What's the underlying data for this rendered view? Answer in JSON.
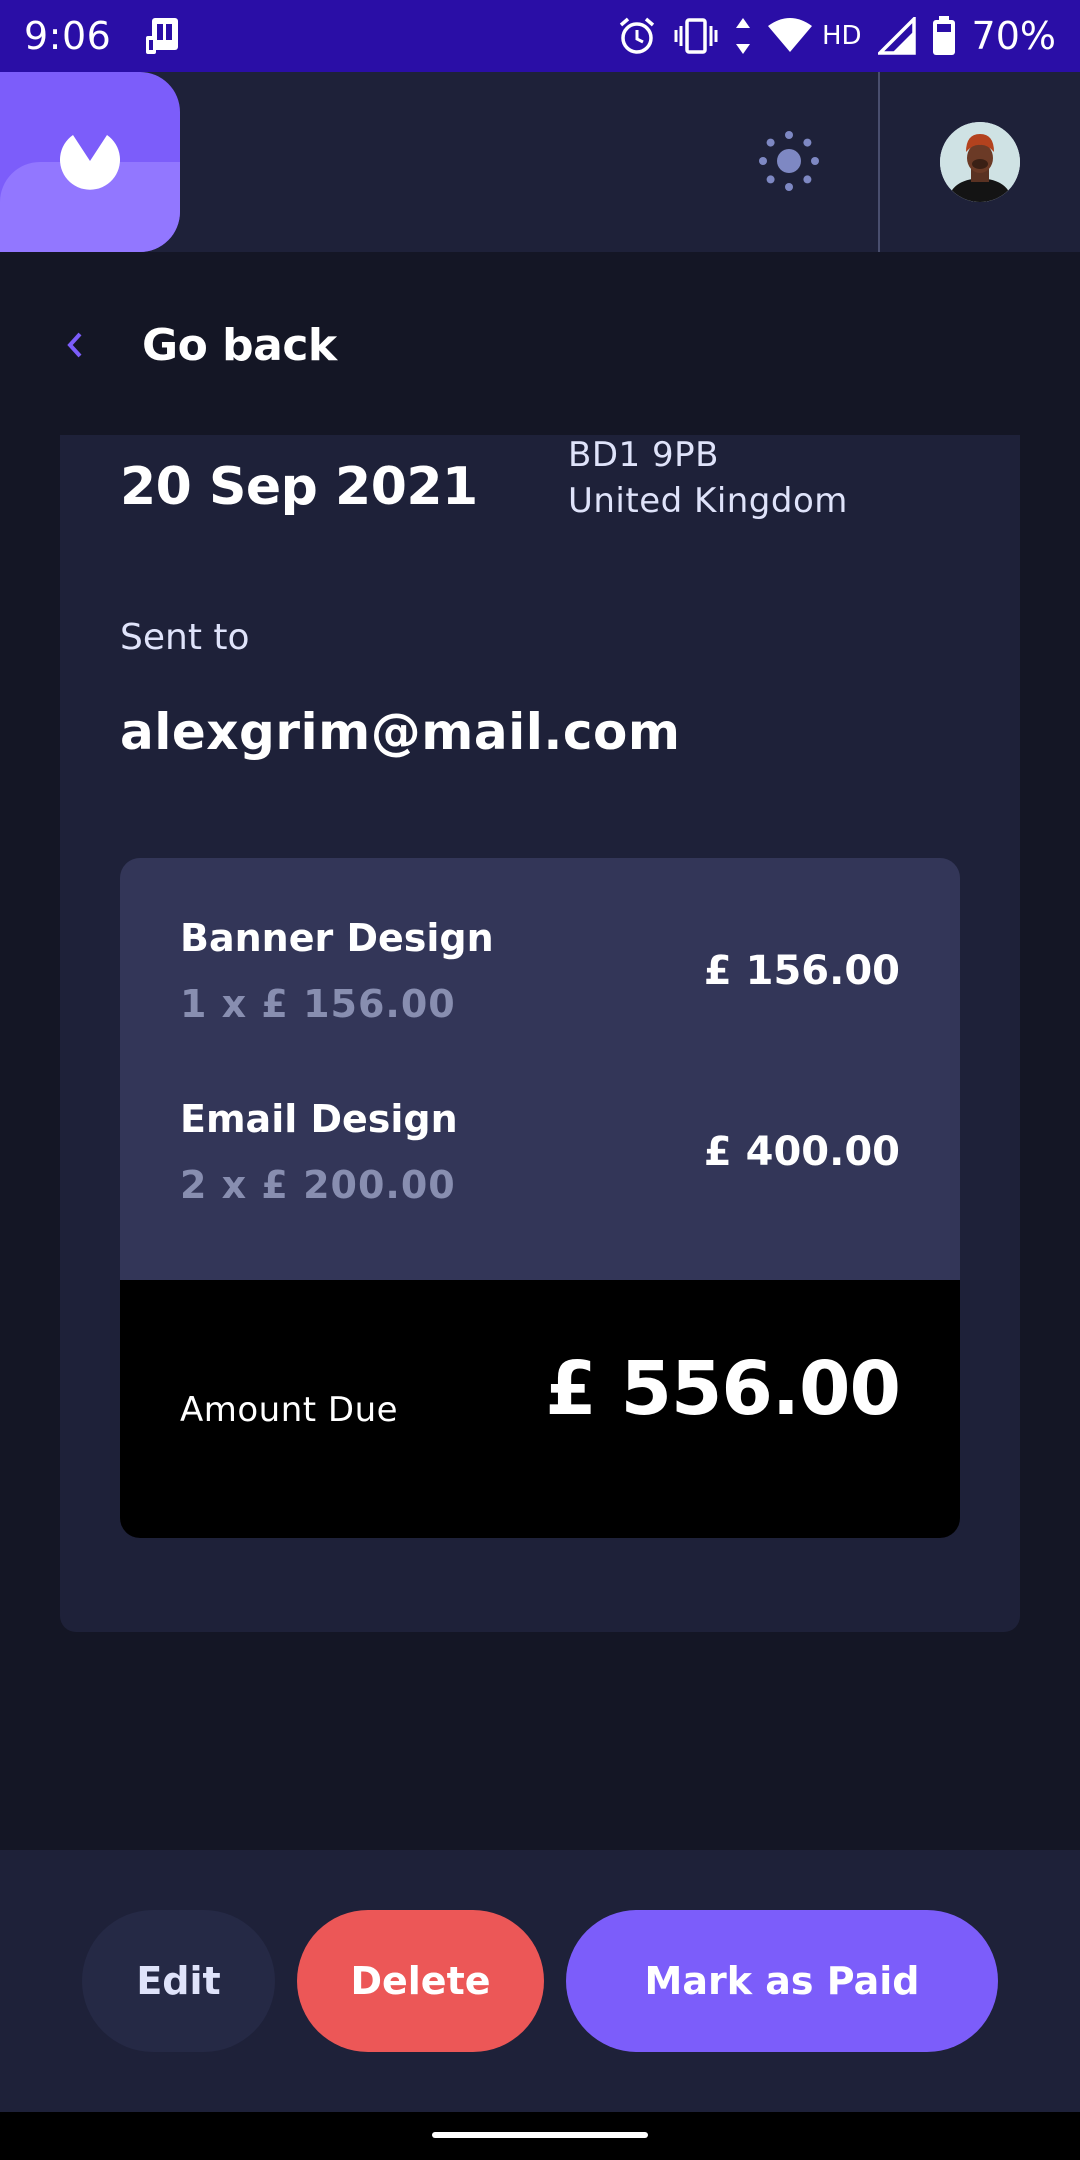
{
  "status_bar": {
    "time": "9:06",
    "battery": "70%",
    "network": "HD",
    "icons": [
      "screen-cast-icon",
      "alarm-icon",
      "vibrate-icon",
      "data-arrows-icon",
      "wifi-icon",
      "signal-icon",
      "battery-icon"
    ]
  },
  "header": {
    "logo_icon": "logo-icon",
    "theme_icon": "sun-icon",
    "avatar_icon": "avatar"
  },
  "nav": {
    "go_back": "Go back"
  },
  "invoice": {
    "date": "20 Sep 2021",
    "address_line_1": "BD1 9PB",
    "address_line_2": "United Kingdom",
    "sent_to_label": "Sent to",
    "sent_to_email": "alexgrim@mail.com",
    "items": [
      {
        "name": "Banner Design",
        "qty_price": "1 x £ 156.00",
        "total": "£ 156.00"
      },
      {
        "name": "Email Design",
        "qty_price": "2 x £ 200.00",
        "total": "£ 400.00"
      }
    ],
    "amount_due_label": "Amount Due",
    "amount_due": "£ 556.00"
  },
  "actions": {
    "edit": "Edit",
    "delete": "Delete",
    "mark_paid": "Mark as Paid"
  },
  "colors": {
    "status_bar": "#2a0ea6",
    "background": "#141625",
    "card": "#1e2139",
    "accent": "#7c5dfa",
    "danger": "#ec5757"
  }
}
